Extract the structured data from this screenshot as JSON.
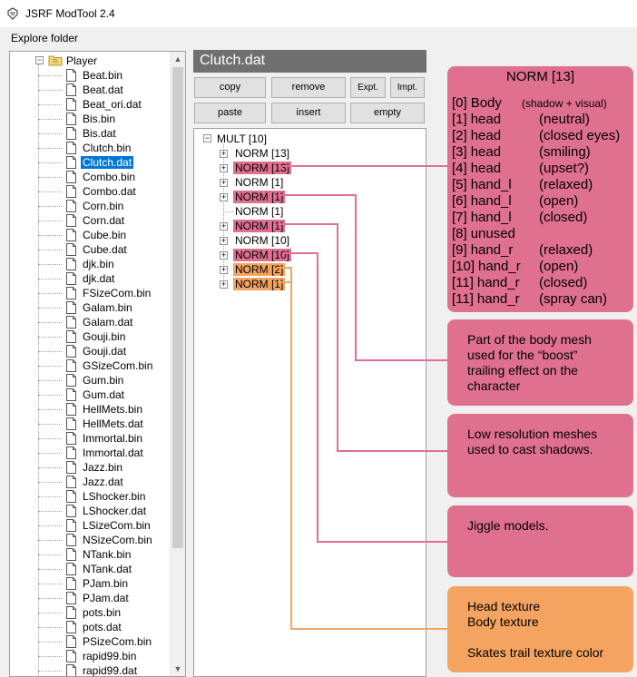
{
  "window": {
    "title": "JSRF ModTool 2.4"
  },
  "menu": {
    "explore_folder": "Explore folder"
  },
  "tree": {
    "folder": "Player",
    "files": [
      {
        "name": "Beat.bin"
      },
      {
        "name": "Beat.dat"
      },
      {
        "name": "Beat_ori.dat"
      },
      {
        "name": "Bis.bin"
      },
      {
        "name": "Bis.dat"
      },
      {
        "name": "Clutch.bin"
      },
      {
        "name": "Clutch.dat",
        "selected": true
      },
      {
        "name": "Combo.bin"
      },
      {
        "name": "Combo.dat"
      },
      {
        "name": "Corn.bin"
      },
      {
        "name": "Corn.dat"
      },
      {
        "name": "Cube.bin"
      },
      {
        "name": "Cube.dat"
      },
      {
        "name": "djk.bin"
      },
      {
        "name": "djk.dat"
      },
      {
        "name": "FSizeCom.bin"
      },
      {
        "name": "Galam.bin"
      },
      {
        "name": "Galam.dat"
      },
      {
        "name": "Gouji.bin"
      },
      {
        "name": "Gouji.dat"
      },
      {
        "name": "GSizeCom.bin"
      },
      {
        "name": "Gum.bin"
      },
      {
        "name": "Gum.dat"
      },
      {
        "name": "HellMets.bin"
      },
      {
        "name": "HellMets.dat"
      },
      {
        "name": "Immortal.bin"
      },
      {
        "name": "Immortal.dat"
      },
      {
        "name": "Jazz.bin"
      },
      {
        "name": "Jazz.dat"
      },
      {
        "name": "LShocker.bin"
      },
      {
        "name": "LShocker.dat"
      },
      {
        "name": "LSizeCom.bin"
      },
      {
        "name": "NSizeCom.bin"
      },
      {
        "name": "NTank.bin"
      },
      {
        "name": "NTank.dat"
      },
      {
        "name": "PJam.bin"
      },
      {
        "name": "PJam.dat"
      },
      {
        "name": "pots.bin"
      },
      {
        "name": "pots.dat"
      },
      {
        "name": "PSizeCom.bin"
      },
      {
        "name": "rapid99.bin"
      },
      {
        "name": "rapid99.dat"
      }
    ]
  },
  "editor": {
    "file_title": "Clutch.dat",
    "buttons": {
      "copy": "copy",
      "remove": "remove",
      "export": "Expt.",
      "import": "Impt.",
      "paste": "paste",
      "insert": "insert",
      "empty": "empty"
    },
    "root_node": "MULT [10]",
    "nodes": [
      {
        "label": "NORM [13]",
        "expandable": true,
        "highlight": "none"
      },
      {
        "label": "NORM [13]",
        "expandable": true,
        "highlight": "pink"
      },
      {
        "label": "NORM [1]",
        "expandable": true,
        "highlight": "none"
      },
      {
        "label": "NORM [1]",
        "expandable": true,
        "highlight": "pink"
      },
      {
        "label": "NORM [1]",
        "expandable": false,
        "highlight": "none"
      },
      {
        "label": "NORM [1]",
        "expandable": true,
        "highlight": "pink"
      },
      {
        "label": "NORM [10]",
        "expandable": true,
        "highlight": "none"
      },
      {
        "label": "NORM [10]",
        "expandable": true,
        "highlight": "pink"
      },
      {
        "label": "NORM [2]",
        "expandable": true,
        "highlight": "orange"
      },
      {
        "label": "NORM [1]",
        "expandable": true,
        "highlight": "orange"
      }
    ]
  },
  "annotations": {
    "norm_box": {
      "title": "NORM [13]",
      "entries": [
        {
          "index": "[0]",
          "name": "Body",
          "note": "(shadow + visual)",
          "small": true
        },
        {
          "index": "[1]",
          "name": "head",
          "note": "(neutral)"
        },
        {
          "index": "[2]",
          "name": "head",
          "note": "(closed eyes)"
        },
        {
          "index": "[3]",
          "name": "head",
          "note": "(smiling)"
        },
        {
          "index": "[4]",
          "name": "head",
          "note": "(upset?)"
        },
        {
          "index": "[5]",
          "name": "hand_l",
          "note": "(relaxed)"
        },
        {
          "index": "[6]",
          "name": "hand_l",
          "note": "(open)"
        },
        {
          "index": "[7]",
          "name": "hand_l",
          "note": "(closed)"
        },
        {
          "index": "[8]",
          "name": "unused",
          "note": ""
        },
        {
          "index": "[9]",
          "name": "hand_r",
          "note": "(relaxed)"
        },
        {
          "index": "[10]",
          "name": "hand_r",
          "note": "(open)"
        },
        {
          "index": "[11]",
          "name": "hand_r",
          "note": "(closed)"
        },
        {
          "index": "[11]",
          "name": "hand_r",
          "note": "(spray can)"
        }
      ]
    },
    "boost": "Part of the body mesh\nused for the “boost”\ntrailing effect on the\ncharacter",
    "shadow": "Low resolution meshes\nused to cast shadows.",
    "jiggle": "Jiggle models.",
    "texture": "Head texture\nBody texture\n\nSkates trail texture color"
  },
  "colors": {
    "pink": "#e0708f",
    "orange": "#f4a460",
    "selection": "#0078d7",
    "title_bar": "#707070"
  }
}
